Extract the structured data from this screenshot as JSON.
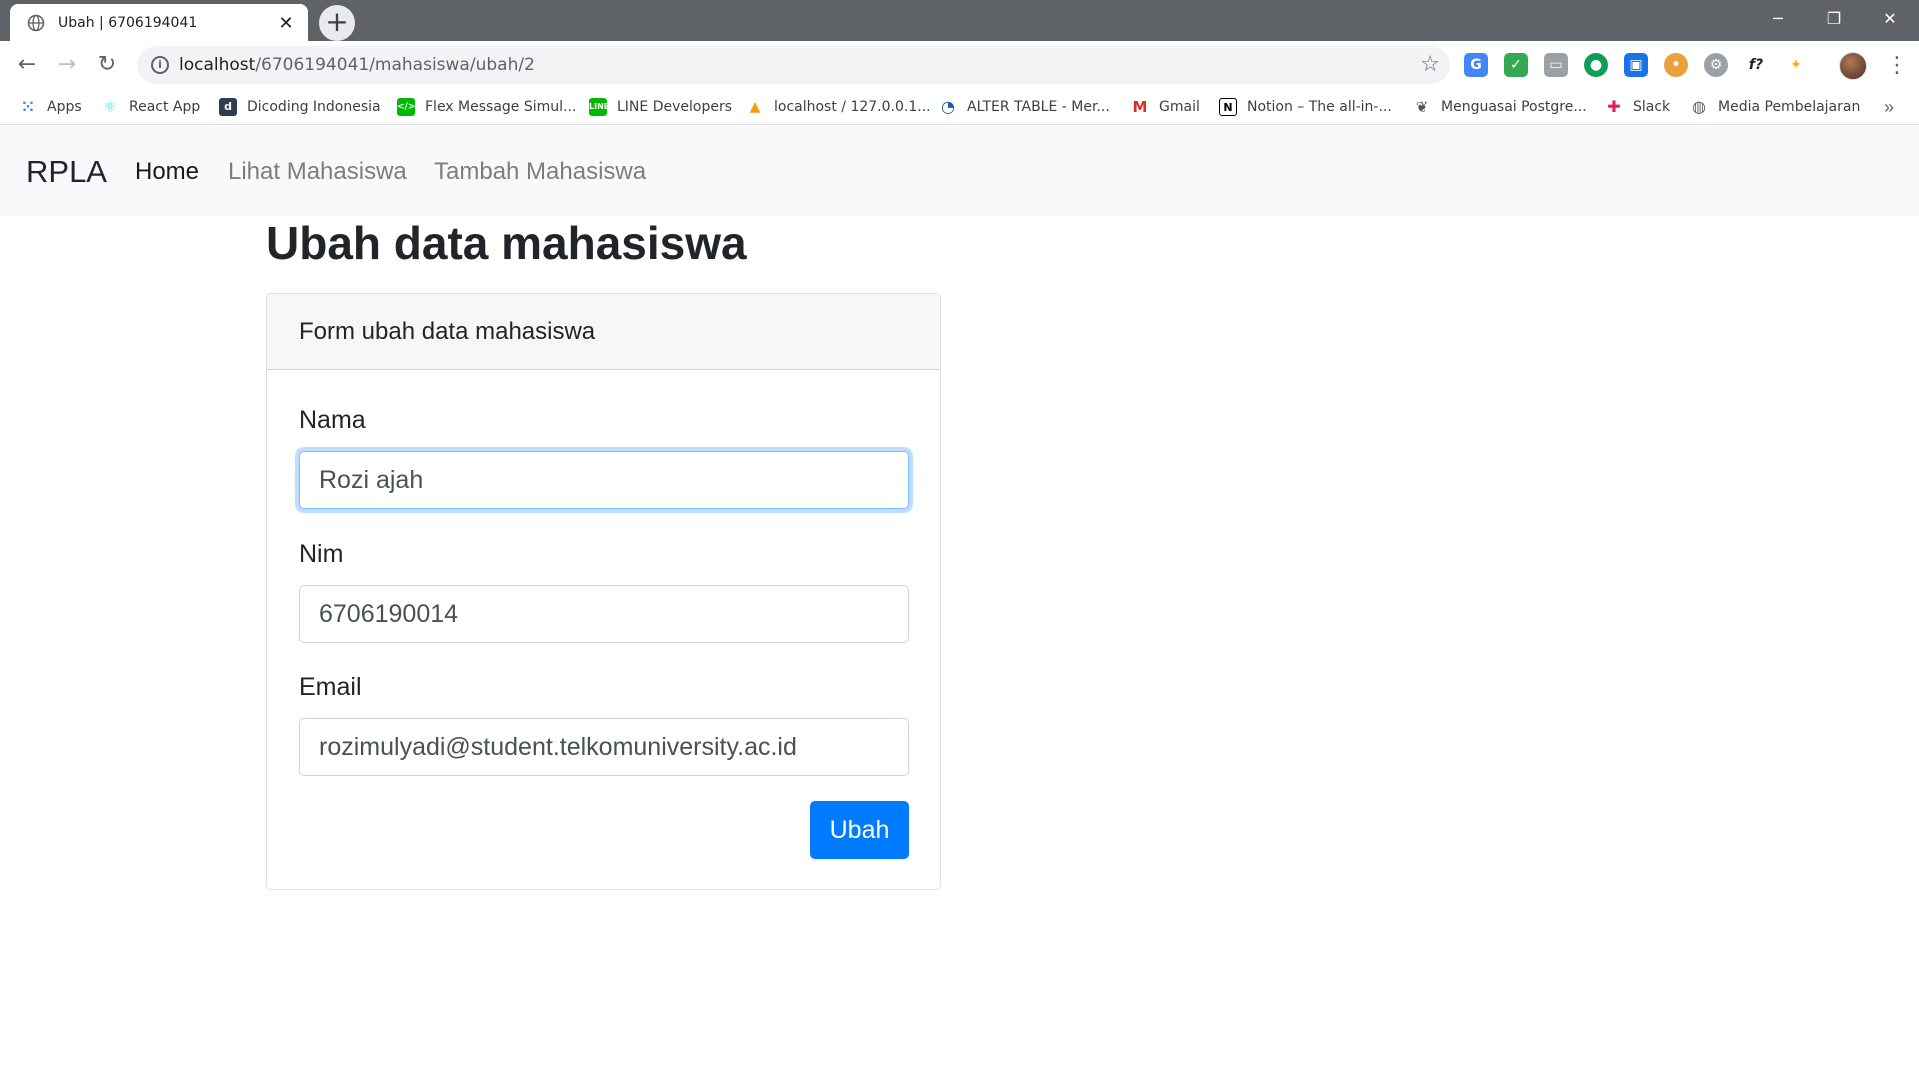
{
  "browser": {
    "tab_title": "Ubah | 6706194041",
    "url_host": "localhost",
    "url_path": "/6706194041/mahasiswa/ubah/2",
    "bookmarks": [
      {
        "label": "Apps",
        "icon": "apps-grid-icon",
        "color": "#4285f4"
      },
      {
        "label": "React App",
        "icon": "react-icon",
        "color": "#61dafb"
      },
      {
        "label": "Dicoding Indonesia",
        "icon": "dicoding-icon",
        "color": "#2d3e50"
      },
      {
        "label": "Flex Message Simul...",
        "icon": "code-icon",
        "color": "#00b900"
      },
      {
        "label": "LINE Developers",
        "icon": "line-icon",
        "color": "#00b900"
      },
      {
        "label": "localhost / 127.0.0.1...",
        "icon": "phpmyadmin-icon",
        "color": "#f89c0e"
      },
      {
        "label": "ALTER TABLE - Mer...",
        "icon": "site-icon",
        "color": "#1e5aa8"
      },
      {
        "label": "Gmail",
        "icon": "gmail-icon",
        "color": "#d93025"
      },
      {
        "label": "Notion – The all-in-...",
        "icon": "notion-icon",
        "color": "#000000"
      },
      {
        "label": "Menguasai Postgre...",
        "icon": "leaf-icon",
        "color": "#555555"
      },
      {
        "label": "Slack",
        "icon": "slack-icon",
        "color": "#4a154b"
      },
      {
        "label": "Media Pembelajaran",
        "icon": "globe-icon",
        "color": "#5f6368"
      }
    ]
  },
  "navbar": {
    "brand": "RPLA",
    "links": [
      {
        "label": "Home",
        "active": true
      },
      {
        "label": "Lihat Mahasiswa",
        "active": false
      },
      {
        "label": "Tambah Mahasiswa",
        "active": false
      }
    ]
  },
  "page": {
    "title": "Ubah data mahasiswa"
  },
  "form": {
    "header": "Form ubah data mahasiswa",
    "fields": [
      {
        "label": "Nama",
        "value": "Rozi ajah"
      },
      {
        "label": "Nim",
        "value": "6706190014"
      },
      {
        "label": "Email",
        "value": "rozimulyadi@student.telkomuniversity.ac.id"
      }
    ],
    "submit_label": "Ubah"
  },
  "colors": {
    "primary": "#007bff",
    "navbar_bg": "#f8f9fa",
    "focus_border": "#80bdff"
  }
}
